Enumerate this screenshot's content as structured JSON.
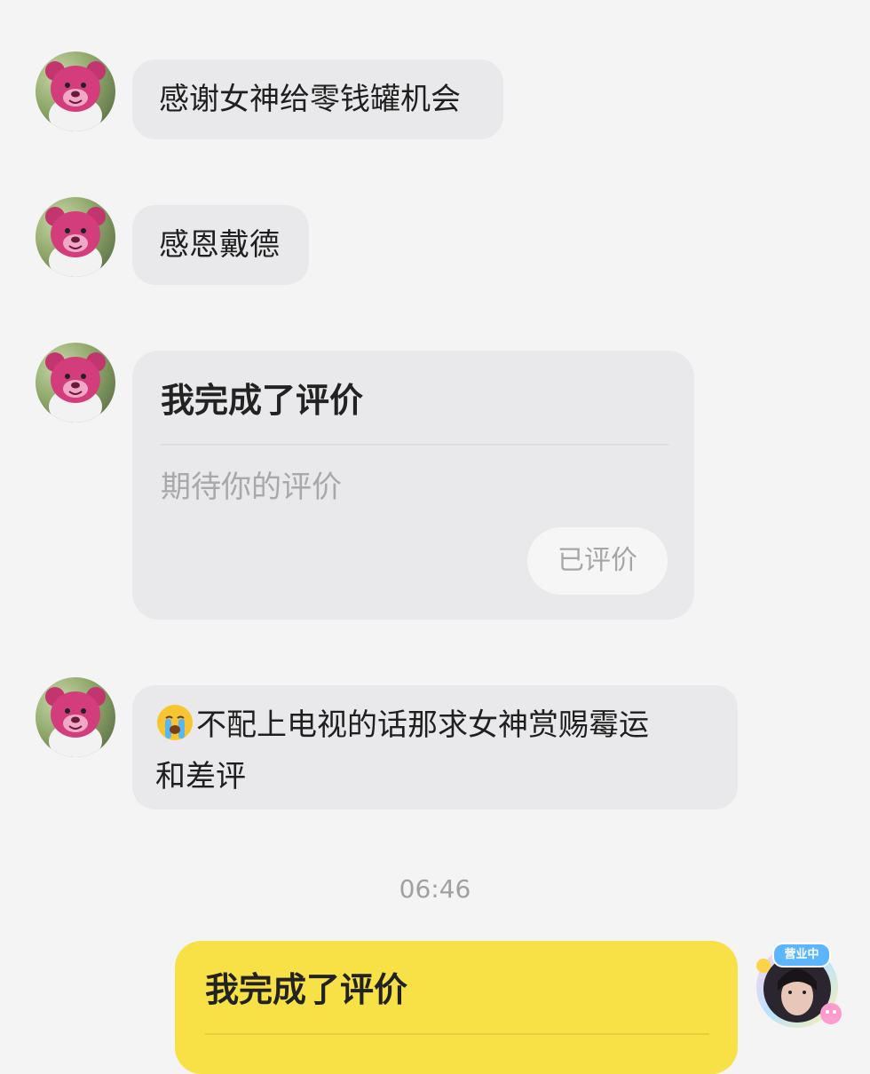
{
  "messages": [
    {
      "type": "text",
      "text": "感谢女神给零钱罐机会"
    },
    {
      "type": "text",
      "text": "感恩戴德"
    },
    {
      "type": "card",
      "title": "我完成了评价",
      "subtitle": "期待你的评价",
      "button": "已评价"
    },
    {
      "type": "text",
      "emoji": "loudly-crying-face",
      "line1": "不配上电视的话那求女神赏赐霉运",
      "line2": "和差评"
    }
  ],
  "timestamp": "06:46",
  "self_card": {
    "title": "我完成了评价"
  },
  "self_avatar": {
    "badge": "营业中"
  },
  "colors": {
    "background": "#f4f4f5",
    "bubble": "#e9e9eb",
    "self_bubble": "#f7e146",
    "muted_text": "#a8a8ab"
  }
}
